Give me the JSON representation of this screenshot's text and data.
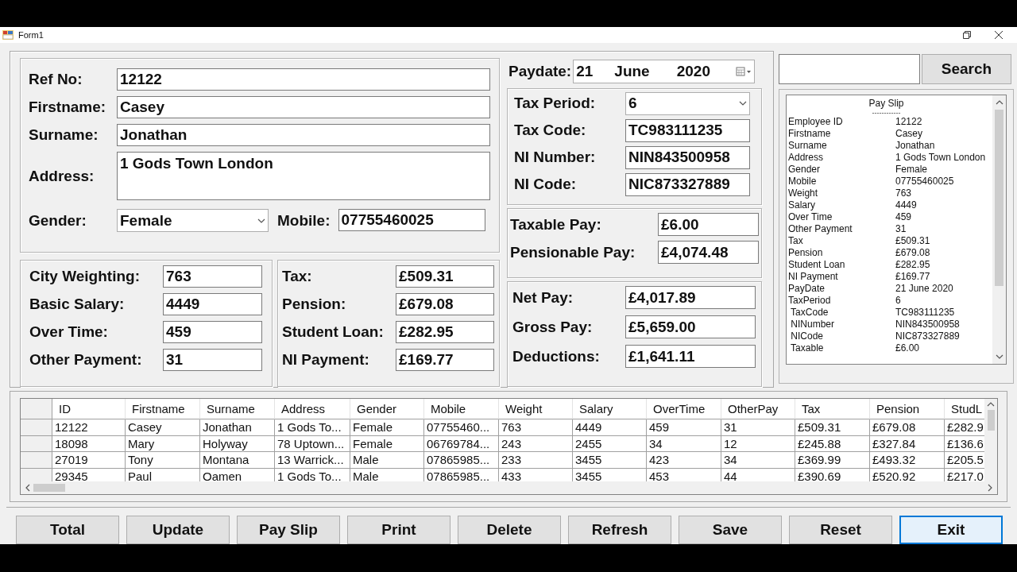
{
  "window": {
    "title": "Form1"
  },
  "employee": {
    "fields": [
      {
        "label": "Ref No:",
        "value": "12122",
        "kind": "text"
      },
      {
        "label": "Firstname:",
        "value": "Casey",
        "kind": "text"
      },
      {
        "label": "Surname:",
        "value": "Jonathan",
        "kind": "text"
      },
      {
        "label": "Address:",
        "value": "1 Gods Town London",
        "kind": "multiline"
      }
    ],
    "gender": {
      "label": "Gender:",
      "value": "Female",
      "kind": "combo"
    },
    "mobile": {
      "label": "Mobile:",
      "value": "07755460025",
      "kind": "text"
    }
  },
  "pay_inputs": [
    {
      "label": "City Weighting:",
      "value": "763",
      "kind": "text"
    },
    {
      "label": "Basic Salary:",
      "value": "4449",
      "kind": "text"
    },
    {
      "label": "Over Time:",
      "value": "459",
      "kind": "text"
    },
    {
      "label": "Other Payment:",
      "value": "31",
      "kind": "text"
    }
  ],
  "deductions": [
    {
      "label": "Tax:",
      "value": "£509.31",
      "kind": "text"
    },
    {
      "label": "Pension:",
      "value": "£679.08",
      "kind": "text"
    },
    {
      "label": "Student Loan:",
      "value": "£282.95",
      "kind": "text"
    },
    {
      "label": "NI Payment:",
      "value": "£169.77",
      "kind": "text"
    }
  ],
  "paydate": {
    "label": "Paydate:",
    "day": "21",
    "month": "June",
    "year": "2020"
  },
  "tax_details": [
    {
      "label": "Tax Period:",
      "value": "6",
      "kind": "combo"
    },
    {
      "label": "Tax Code:",
      "value": "TC983111235",
      "kind": "text"
    },
    {
      "label": "NI Number:",
      "value": "NIN843500958",
      "kind": "text"
    },
    {
      "label": "NI Code:",
      "value": "NIC873327889",
      "kind": "text"
    }
  ],
  "pay_summary": [
    {
      "label": "Taxable Pay:",
      "value": "£6.00",
      "kind": "text"
    },
    {
      "label": "Pensionable Pay:",
      "value": "£4,074.48",
      "kind": "text"
    }
  ],
  "totals": [
    {
      "label": "Net Pay:",
      "value": "£4,017.89",
      "kind": "text"
    },
    {
      "label": "Gross Pay:",
      "value": "£5,659.00",
      "kind": "text"
    },
    {
      "label": "Deductions:",
      "value": "£1,641.11",
      "kind": "text"
    }
  ],
  "search": {
    "button": "Search"
  },
  "pay_slip": {
    "title": "Pay Slip",
    "underline": "------------",
    "rows": [
      [
        "Employee ID",
        "12122"
      ],
      [
        "Firstname",
        "Casey"
      ],
      [
        "Surname",
        "Jonathan"
      ],
      [
        "Address",
        "1 Gods Town London"
      ],
      [
        "Gender",
        "Female"
      ],
      [
        "Mobile",
        "07755460025"
      ],
      [
        "Weight",
        "763"
      ],
      [
        "Salary",
        "4449"
      ],
      [
        "Over Time",
        "459"
      ],
      [
        "Other Payment",
        "31"
      ],
      [
        "Tax",
        "£509.31"
      ],
      [
        "Pension",
        "£679.08"
      ],
      [
        "Student Loan",
        "£282.95"
      ],
      [
        "NI Payment",
        "£169.77"
      ],
      [
        "PayDate",
        "21 June 2020"
      ],
      [
        "TaxPeriod",
        "6"
      ],
      [
        " TaxCode",
        "TC983111235"
      ],
      [
        " NINumber",
        "NIN843500958"
      ],
      [
        " NICode",
        "NIC873327889"
      ],
      [
        " Taxable",
        "£6.00"
      ]
    ]
  },
  "table": {
    "columns": [
      "ID",
      "Firstname",
      "Surname",
      "Address",
      "Gender",
      "Mobile",
      "Weight",
      "Salary",
      "OverTime",
      "OtherPay",
      "Tax",
      "Pension",
      "StudL"
    ],
    "rows": [
      [
        "12122",
        "Casey",
        "Jonathan",
        "1 Gods To...",
        "Female",
        "07755460...",
        "763",
        "4449",
        "459",
        "31",
        "£509.31",
        "£679.08",
        "£282.9"
      ],
      [
        "18098",
        "Mary",
        "Holyway",
        "78 Uptown...",
        "Female",
        "06769784...",
        "243",
        "2455",
        "34",
        "12",
        "£245.88",
        "£327.84",
        "£136.6"
      ],
      [
        "27019",
        "Tony",
        "Montana",
        "13 Warrick...",
        "Male",
        "07865985...",
        "233",
        "3455",
        "423",
        "34",
        "£369.99",
        "£493.32",
        "£205.5"
      ],
      [
        "29345",
        "Paul",
        "Oamen",
        "1 Gods To...",
        "Male",
        "07865985...",
        "433",
        "3455",
        "453",
        "44",
        "£390.69",
        "£520.92",
        "£217.0"
      ]
    ]
  },
  "buttons": [
    {
      "label": "Total",
      "focused": false
    },
    {
      "label": "Update",
      "focused": false
    },
    {
      "label": "Pay Slip",
      "focused": false
    },
    {
      "label": "Print",
      "focused": false
    },
    {
      "label": "Delete",
      "focused": false
    },
    {
      "label": "Refresh",
      "focused": false
    },
    {
      "label": "Save",
      "focused": false
    },
    {
      "label": "Reset",
      "focused": false
    },
    {
      "label": "Exit",
      "focused": true
    }
  ]
}
